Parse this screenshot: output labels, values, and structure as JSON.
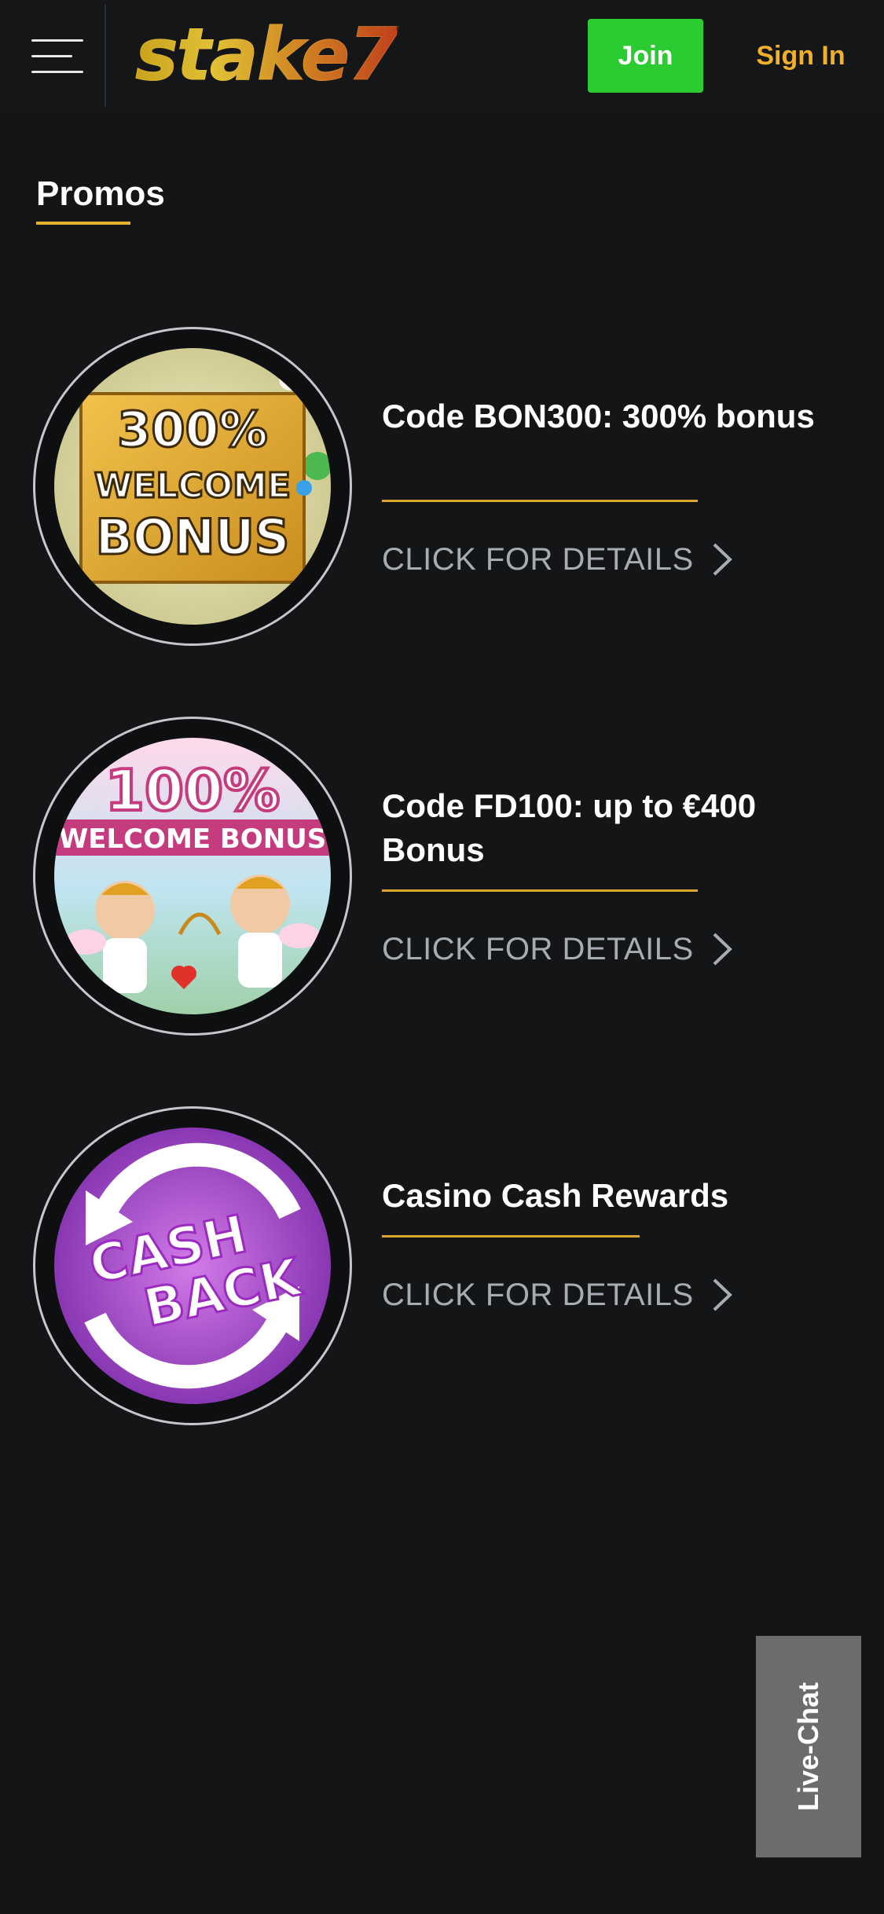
{
  "header": {
    "logo_text": "stake7",
    "join_label": "Join",
    "signin_label": "Sign In"
  },
  "page": {
    "title": "Promos"
  },
  "promos": [
    {
      "title": "Code BON300: 300% bonus",
      "cta": "CLICK FOR DETAILS",
      "image": {
        "lines": [
          "300%",
          "WELCOME",
          "BONUS"
        ]
      }
    },
    {
      "title": "Code FD100: up to €400 Bonus",
      "cta": "CLICK FOR DETAILS",
      "image": {
        "lines": [
          "100%",
          "WELCOME BONUS"
        ]
      }
    },
    {
      "title": "Casino Cash Rewards",
      "cta": "CLICK FOR DETAILS",
      "image": {
        "lines": [
          "CASH",
          "BACK"
        ]
      }
    }
  ],
  "live_chat": {
    "label": "Live-Chat"
  },
  "colors": {
    "background": "#131517",
    "join_green": "#2bcc31",
    "accent_gold": "#e6b12e",
    "cta_gray": "#a9abb3",
    "live_chat_gray": "#6b6c6e"
  }
}
